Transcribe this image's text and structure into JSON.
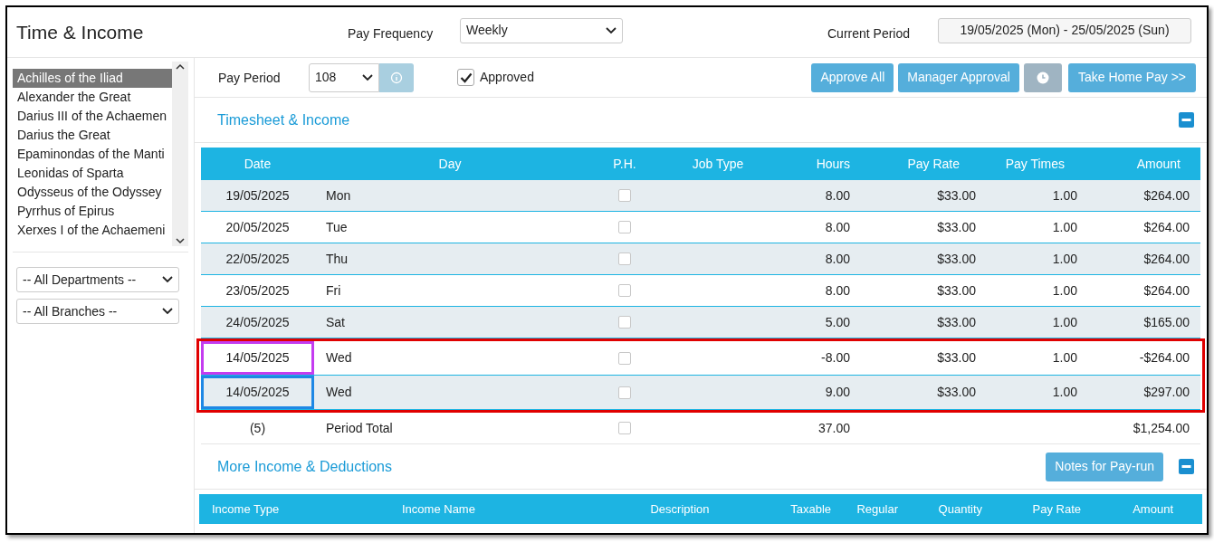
{
  "header": {
    "title": "Time & Income",
    "pay_frequency_label": "Pay Frequency",
    "pay_frequency": "Weekly",
    "current_period_label": "Current Period",
    "current_period": "19/05/2025 (Mon) - 25/05/2025 (Sun)"
  },
  "sidebar": {
    "employees": [
      {
        "name": "Achilles of the Iliad",
        "selected": true
      },
      {
        "name": "Alexander the Great",
        "selected": false
      },
      {
        "name": "Darius III of the Achaemen",
        "selected": false
      },
      {
        "name": "Darius the Great",
        "selected": false
      },
      {
        "name": "Epaminondas of the Manti",
        "selected": false
      },
      {
        "name": "Leonidas of Sparta",
        "selected": false
      },
      {
        "name": "Odysseus of the Odyssey",
        "selected": false
      },
      {
        "name": "Pyrrhus of Epirus",
        "selected": false
      },
      {
        "name": "Xerxes I of the Achaemeni",
        "selected": false
      }
    ],
    "filters": [
      "-- All Departments --",
      "-- All Branches --"
    ]
  },
  "toolbar": {
    "pay_period_label": "Pay Period",
    "pay_period": "108",
    "approved_label": "Approved",
    "approved": true,
    "buttons": [
      "Approve All",
      "Manager Approval"
    ],
    "take_home_button": "Take Home Pay >>"
  },
  "timesheet": {
    "title": "Timesheet & Income",
    "columns": [
      "Date",
      "Day",
      "P.H.",
      "Job Type",
      "Hours",
      "Pay Rate",
      "Pay Times",
      "Amount"
    ],
    "rows": [
      {
        "date": "19/05/2025",
        "day": "Mon",
        "ph": false,
        "job_type": "",
        "hours": "8.00",
        "pay_rate": "$33.00",
        "pay_times": "1.00",
        "amount": "$264.00",
        "flagged": false
      },
      {
        "date": "20/05/2025",
        "day": "Tue",
        "ph": false,
        "hours": "8.00",
        "pay_rate": "$33.00",
        "pay_times": "1.00",
        "amount": "$264.00",
        "flagged": false
      },
      {
        "date": "22/05/2025",
        "day": "Thu",
        "ph": false,
        "hours": "8.00",
        "pay_rate": "$33.00",
        "pay_times": "1.00",
        "amount": "$264.00",
        "flagged": false
      },
      {
        "date": "23/05/2025",
        "day": "Fri",
        "ph": false,
        "hours": "8.00",
        "pay_rate": "$33.00",
        "pay_times": "1.00",
        "amount": "$264.00",
        "flagged": false
      },
      {
        "date": "24/05/2025",
        "day": "Sat",
        "ph": false,
        "hours": "5.00",
        "pay_rate": "$33.00",
        "pay_times": "1.00",
        "amount": "$165.00",
        "flagged": false
      },
      {
        "date": "14/05/2025",
        "day": "Wed",
        "ph": false,
        "hours": "-8.00",
        "pay_rate": "$33.00",
        "pay_times": "1.00",
        "amount": "-$264.00",
        "flagged": true,
        "color": "#c43cf0"
      },
      {
        "date": "14/05/2025",
        "day": "Wed",
        "ph": false,
        "hours": "9.00",
        "pay_rate": "$33.00",
        "pay_times": "1.00",
        "amount": "$297.00",
        "flagged": true,
        "color": "#1e88e5"
      }
    ],
    "total": {
      "count": "(5)",
      "label": "Period Total",
      "ph": false,
      "hours": "37.00",
      "amount": "$1,254.00"
    }
  },
  "more_income": {
    "title": "More Income & Deductions",
    "notes_button": "Notes for Pay-run",
    "columns": [
      "Income Type",
      "Income Name",
      "Description",
      "Taxable",
      "Regular",
      "Quantity",
      "Pay Rate",
      "Amount"
    ]
  }
}
